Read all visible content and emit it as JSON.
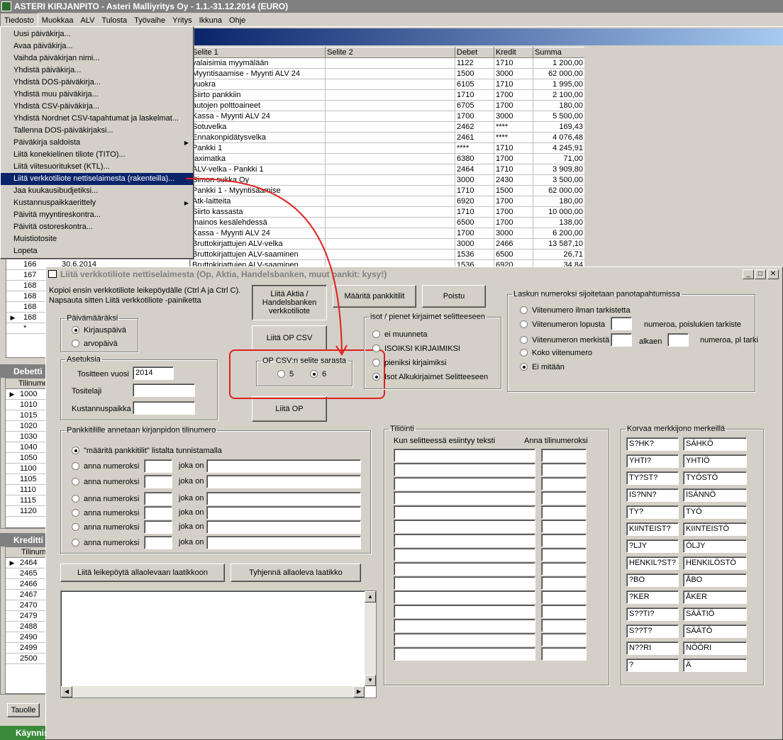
{
  "app": {
    "title": "ASTERI KIRJANPITO - Asteri Malliyritys Oy - 1.1.-31.12.2014 (EURO)"
  },
  "menubar": [
    "Tiedosto",
    "Muokkaa",
    "ALV",
    "Tulosta",
    "Työvaihe",
    "Yritys",
    "Ikkuna",
    "Ohje"
  ],
  "file_menu": [
    "Uusi päiväkirja...",
    "Avaa päiväkirja...",
    "Vaihda päiväkirjan nimi...",
    "Yhdistä päiväkirja...",
    "Yhdistä DOS-päiväkirja...",
    "Yhdistä muu päiväkirja...",
    "Yhdistä CSV-päiväkirja...",
    "Yhdistä Nordnet CSV-tapahtumat ja laskelmat...",
    "Tallenna DOS-päiväkirjaksi...",
    "Päiväkirja saldoista",
    "Liitä konekielinen tiliote (TITO)...",
    "Liitä viitesuoritukset (KTL)...",
    "Liitä verkkotiliote nettiselaimesta (rakenteilla)...",
    "Jaa kuukausibudjetiksi...",
    "Kustannuspaikkaerittely",
    "Päivitä myyntireskontra...",
    "Päivitä ostoreskontra...",
    "Muistiotosite",
    "Lopeta"
  ],
  "journal": {
    "headers": [
      "Selite 1",
      "Selite 2",
      "Debet",
      "Kredit",
      "Summa"
    ],
    "rows": [
      [
        "valaisimia myymälään",
        "",
        "1122",
        "1710",
        "1 200,00"
      ],
      [
        "Myyntisaamise - Myynti ALV 24",
        "",
        "1500",
        "3000",
        "62 000,00"
      ],
      [
        "vuokra",
        "",
        "6105",
        "1710",
        "1 995,00"
      ],
      [
        "Siirto pankkiin",
        "",
        "1710",
        "1700",
        "2 100,00"
      ],
      [
        "autojen polttoaineet",
        "",
        "6705",
        "1700",
        "180,00"
      ],
      [
        "Kassa - Myynti ALV 24",
        "",
        "1700",
        "3000",
        "5 500,00"
      ],
      [
        "Sotuvelka",
        "",
        "2462",
        "****",
        "169,43"
      ],
      [
        "Ennakonpidätysvelka",
        "",
        "2461",
        "****",
        "4 076,48"
      ],
      [
        "Pankki 1",
        "",
        "****",
        "1710",
        "4 245,91"
      ],
      [
        "taximatka",
        "",
        "6380",
        "1700",
        "71,00"
      ],
      [
        "ALV-velka - Pankki 1",
        "",
        "2464",
        "1710",
        "3 909,80"
      ],
      [
        "Simon sukka Oy",
        "",
        "3000",
        "2430",
        "3 500,00"
      ],
      [
        "Pankki 1 - Myyntisaamise",
        "",
        "1710",
        "1500",
        "62 000,00"
      ],
      [
        "Atk-laitteita",
        "",
        "6920",
        "1700",
        "180,00"
      ],
      [
        "Siirto kassasta",
        "",
        "1710",
        "1700",
        "10 000,00"
      ],
      [
        "mainos kesälehdessä",
        "",
        "6500",
        "1700",
        "138,00"
      ],
      [
        "Kassa - Myynti ALV 24",
        "",
        "1700",
        "3000",
        "6 200,00"
      ],
      [
        "Bruttokirjattujen ALV-velka",
        "",
        "3000",
        "2466",
        "13 587,10"
      ],
      [
        "Bruttokirjattujen ALV-saaminen",
        "",
        "1536",
        "6500",
        "26,71"
      ],
      [
        "Bruttokirjattujen ALV-saaminen",
        "",
        "1536",
        "6920",
        "34,84"
      ]
    ]
  },
  "left_rows": [
    {
      "no": "166",
      "date": "30.6.2014"
    },
    {
      "no": "167",
      "date": ""
    },
    {
      "no": "168",
      "date": ""
    },
    {
      "no": "168",
      "date": ""
    },
    {
      "no": "168",
      "date": ""
    },
    {
      "no": "168",
      "date": ""
    },
    {
      "no": "*",
      "date": ""
    }
  ],
  "debet_win": {
    "title": "Debetti",
    "header": "Tilinume",
    "rows": [
      "1000",
      "1010",
      "1015",
      "1020",
      "1030",
      "1040",
      "1050",
      "1100",
      "1105",
      "1110",
      "1115",
      "1120"
    ]
  },
  "kredit_win": {
    "title": "Kreditti",
    "header": "Tilinum",
    "rows": [
      "2464",
      "2465",
      "2466",
      "2467",
      "2470",
      "2479",
      "2488",
      "2490",
      "2499",
      "2500"
    ]
  },
  "taskbar": {
    "tauolle": "Tauolle",
    "start": "Käynnis"
  },
  "dialog": {
    "title": "Liitä verkkotiliote nettiselaimesta (Op, Aktia, Handelsbanken, muut pankit: kysy!)",
    "intro1": "Kopioi ensin verkkotiliote leikepöydälle (Ctrl A ja Ctrl C).",
    "intro2": "Napsauta sitten Liitä verkkotiliote -painiketta",
    "btn_aktia": "Liitä Aktia / Handelsbanken verkkotiliote",
    "btn_maarita": "Määritä pankkitilit",
    "btn_poistu": "Poistu",
    "btn_op_csv": "Liitä OP CSV",
    "btn_op": "Liitä OP",
    "date_group": {
      "legend": "Päivämääräksi",
      "opt1": "Kirjauspäivä",
      "opt2": "arvopäivä"
    },
    "settings": {
      "legend": "Asetuksia",
      "year_label": "Tositteen vuosi",
      "year_value": "2014",
      "type_label": "Tositelaji",
      "cost_label": "Kustannuspaikka"
    },
    "opcsv": {
      "legend": "OP CSV:n selite sarasta",
      "opt1": "5",
      "opt2": "6"
    },
    "case_group": {
      "legend": "isot / pienet kirjaimet selitteeseen",
      "opts": [
        "ei muunneta",
        "ISOIKSI KIRJAIMIKSI",
        "pieniksi kirjaimiksi",
        "Isot Alkukirjaimet Selitteeseen"
      ]
    },
    "ref_group": {
      "legend": "Laskun numeroksi sijoitetaan panotapahtumissa",
      "opt1": "Viitenumero ilman tarkistetta",
      "opt2": "Viitenumeron lopusta",
      "opt2_suffix": "numeroa, poislukien tarkiste",
      "opt3": "Viitenumeron merkistä",
      "opt3_mid": "alkaen",
      "opt3_suffix": "numeroa, pl tarkiste",
      "opt4": "Koko viitenumero",
      "opt5": "Ei mitään"
    },
    "bank_group": {
      "legend": "Pankkitilille annetaan kirjanpidon tilinumero",
      "opt1": "\"määritä pankkitilit\" listalta tunnistamalla",
      "opt_other": "anna numeroksi",
      "joka_on": "joka on"
    },
    "btn_paste": "Liitä leikepöytä allaolevaan laatikkoon",
    "btn_clear": "Tyhjennä allaoleva laatikko",
    "tilointi": {
      "legend": "Tiliöinti",
      "col1": "Kun selitteessä esiintyy teksti",
      "col2": "Anna tilinumeroksi"
    },
    "replace": {
      "legend": "Korvaa merkkijono  merkeillä",
      "pairs": [
        [
          "S?HK?",
          "SÄHKÖ"
        ],
        [
          "YHTI?",
          "YHTIÖ"
        ],
        [
          "TY?ST?",
          "TYÖSTÖ"
        ],
        [
          "IS?NN?",
          "ISÄNNÖ"
        ],
        [
          "TY?",
          "TYÖ"
        ],
        [
          "KIINTEIST?",
          "KIINTEISTÖ"
        ],
        [
          "?LJY",
          "ÖLJY"
        ],
        [
          "HENKIL?ST?",
          "HENKILÖSTÖ"
        ],
        [
          "?BO",
          "ÅBO"
        ],
        [
          "?KER",
          "ÅKER"
        ],
        [
          "S??TI?",
          "SÄÄTIÖ"
        ],
        [
          "S??T?",
          "SÄÄTÖ"
        ],
        [
          "N??RI",
          "NÖÖRI"
        ],
        [
          "?",
          "Ä"
        ]
      ]
    }
  }
}
